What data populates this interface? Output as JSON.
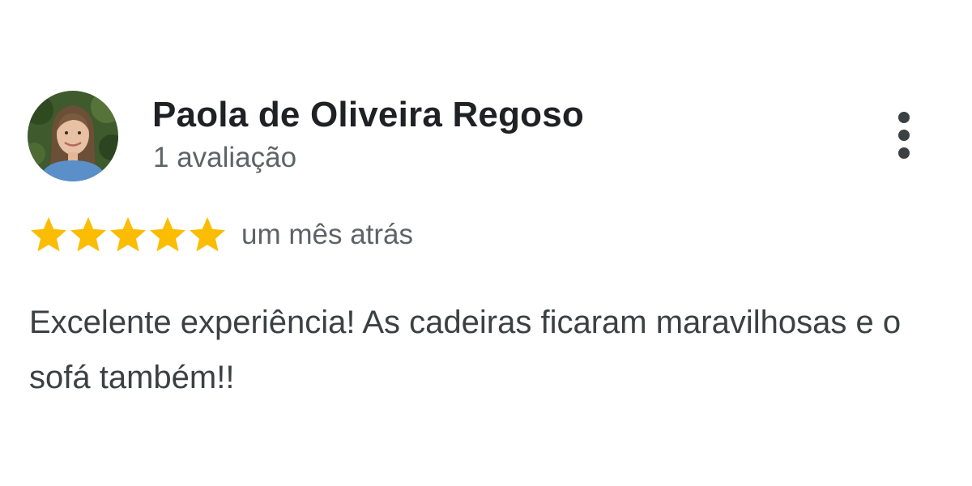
{
  "review": {
    "author": {
      "name": "Paola de Oliveira Regoso",
      "meta": "1 avaliação",
      "avatar_icon": "profile-photo"
    },
    "rating": {
      "value": 5,
      "max": 5,
      "star_color": "#FBBC04"
    },
    "time": "um mês atrás",
    "text": "Excelente experiência! As cadeiras ficaram maravilhosas e o sofá também!!",
    "menu_icon": "more-vert-icon"
  }
}
